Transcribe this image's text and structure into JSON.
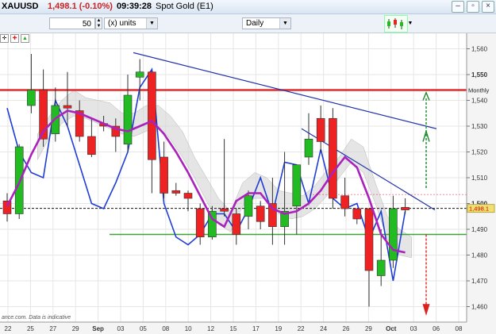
{
  "window": {
    "symbol": "XAUUSD",
    "price": "1,498.1 (-0.10%)",
    "time": "09:39:28",
    "description": "Spot Gold (E1)"
  },
  "toolbar": {
    "period_value": "50",
    "units_label": "(x) units",
    "timeframe": "Daily"
  },
  "chart_data": {
    "type": "candlestick",
    "ylim": [
      1454,
      1566
    ],
    "y_ticks": [
      1460,
      1470,
      1480,
      1490,
      1500,
      1510,
      1520,
      1530,
      1540,
      1550,
      1560
    ],
    "x_ticks": [
      "22",
      "25",
      "27",
      "29",
      "Sep",
      "03",
      "05",
      "08",
      "10",
      "12",
      "15",
      "17",
      "19",
      "22",
      "24",
      "26",
      "29",
      "Oct",
      "03",
      "06",
      "08"
    ],
    "price_tag": "1,498.1",
    "monthly_label": "Monthly",
    "footer_note": "ance.com. Data is indicative",
    "candles": [
      {
        "o": 1501,
        "h": 1504,
        "l": 1493,
        "c": 1496
      },
      {
        "o": 1496,
        "h": 1523,
        "l": 1494,
        "c": 1522
      },
      {
        "o": 1538,
        "h": 1558,
        "l": 1535,
        "c": 1544
      },
      {
        "o": 1544,
        "h": 1552,
        "l": 1522,
        "c": 1525
      },
      {
        "o": 1527,
        "h": 1545,
        "l": 1524,
        "c": 1538
      },
      {
        "o": 1538,
        "h": 1551,
        "l": 1530,
        "c": 1537
      },
      {
        "o": 1536,
        "h": 1540,
        "l": 1524,
        "c": 1526
      },
      {
        "o": 1526,
        "h": 1533,
        "l": 1518,
        "c": 1519
      },
      {
        "o": 1531,
        "h": 1534,
        "l": 1528,
        "c": 1530
      },
      {
        "o": 1530,
        "h": 1533,
        "l": 1520,
        "c": 1526
      },
      {
        "o": 1523,
        "h": 1550,
        "l": 1520,
        "c": 1542
      },
      {
        "o": 1549,
        "h": 1556,
        "l": 1540,
        "c": 1551
      },
      {
        "o": 1551,
        "h": 1550,
        "l": 1504,
        "c": 1517
      },
      {
        "o": 1518,
        "h": 1524,
        "l": 1502,
        "c": 1504
      },
      {
        "o": 1505,
        "h": 1508,
        "l": 1503,
        "c": 1504
      },
      {
        "o": 1504,
        "h": 1505,
        "l": 1497,
        "c": 1502
      },
      {
        "o": 1498,
        "h": 1500,
        "l": 1484,
        "c": 1487
      },
      {
        "o": 1487,
        "h": 1499,
        "l": 1486,
        "c": 1497
      },
      {
        "o": 1498,
        "h": 1525,
        "l": 1495,
        "c": 1497
      },
      {
        "o": 1496,
        "h": 1498,
        "l": 1484,
        "c": 1488
      },
      {
        "o": 1495,
        "h": 1505,
        "l": 1490,
        "c": 1503
      },
      {
        "o": 1499,
        "h": 1501,
        "l": 1490,
        "c": 1493
      },
      {
        "o": 1500,
        "h": 1510,
        "l": 1484,
        "c": 1491
      },
      {
        "o": 1491,
        "h": 1520,
        "l": 1484,
        "c": 1497
      },
      {
        "o": 1499,
        "h": 1510,
        "l": 1488,
        "c": 1515
      },
      {
        "o": 1518,
        "h": 1535,
        "l": 1515,
        "c": 1525
      },
      {
        "o": 1533,
        "h": 1538,
        "l": 1520,
        "c": 1524
      },
      {
        "o": 1533,
        "h": 1537,
        "l": 1498,
        "c": 1502
      },
      {
        "o": 1503,
        "h": 1510,
        "l": 1495,
        "c": 1498
      },
      {
        "o": 1498,
        "h": 1496,
        "l": 1492,
        "c": 1494
      },
      {
        "o": 1498,
        "h": 1498,
        "l": 1460,
        "c": 1474
      },
      {
        "o": 1472,
        "h": 1490,
        "l": 1468,
        "c": 1478
      },
      {
        "o": 1478,
        "h": 1503,
        "l": 1475,
        "c": 1498
      },
      {
        "o": 1498.5,
        "h": 1502,
        "l": 1496,
        "c": 1497.5
      }
    ],
    "ma_line": [
      1499,
      1508,
      1519,
      1528,
      1533,
      1536,
      1535,
      1533,
      1531,
      1529,
      1528,
      1530,
      1532,
      1527,
      1520,
      1512,
      1503,
      1494,
      1491,
      1501,
      1504,
      1504,
      1498,
      1496,
      1497,
      1500,
      1505,
      1512,
      1518,
      1514,
      1502,
      1488,
      1482,
      1481
    ],
    "blue_line": [
      1537,
      1520,
      1512,
      1510,
      1540,
      1530,
      1515,
      1500,
      1498,
      1508,
      1520,
      1545,
      1552,
      1500,
      1487,
      1484,
      1488,
      1496,
      1496,
      1489,
      1498,
      1510,
      1496,
      1516,
      1515,
      1500,
      1521,
      1502,
      1498,
      1500,
      1486,
      1497,
      1470,
      1497
    ],
    "blue_line_x": [
      0,
      1,
      2,
      3,
      4,
      5,
      6,
      7,
      8,
      9,
      10,
      11,
      12,
      13,
      14,
      15,
      16,
      17,
      18,
      19,
      20,
      21,
      22,
      23,
      24,
      25,
      26,
      27,
      28,
      29,
      30,
      31,
      32,
      33
    ]
  },
  "colors": {
    "up": "#22bb22",
    "down": "#ee2222",
    "ma": "#aa22bb",
    "blue": "#1f3dd6",
    "trend": "#2233aa",
    "resistance": "#e02c2c",
    "support": "#3aa435",
    "arrow_up": "#1b8a2a",
    "arrow_down": "#dd2222"
  }
}
